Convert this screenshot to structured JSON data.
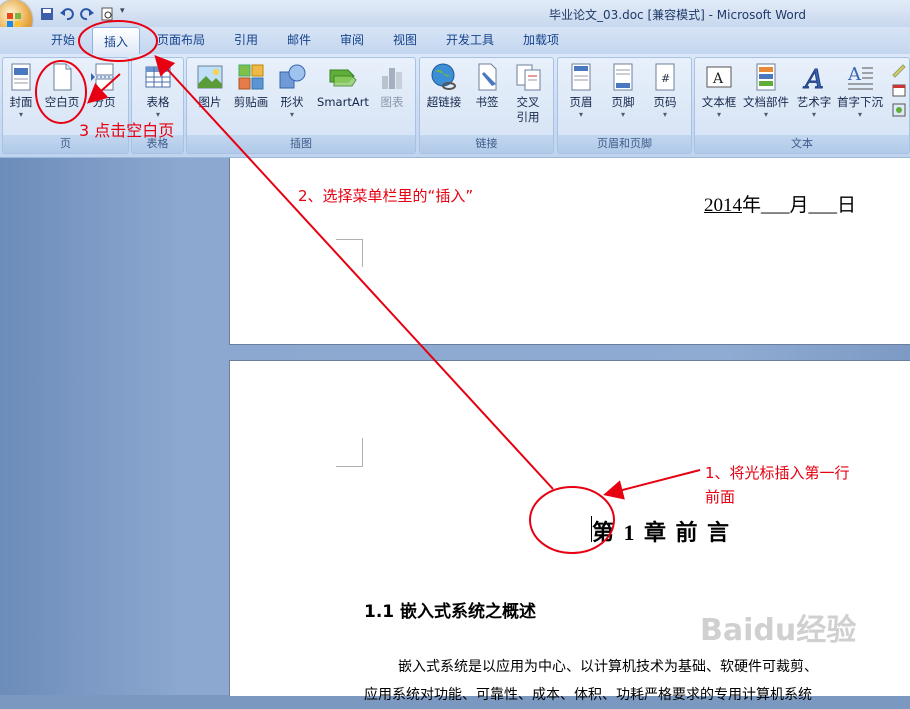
{
  "window": {
    "title": "毕业论文_03.doc [兼容模式] - Microsoft Word"
  },
  "tabs": [
    "开始",
    "插入",
    "页面布局",
    "引用",
    "邮件",
    "审阅",
    "视图",
    "开发工具",
    "加载项"
  ],
  "active_tab": "插入",
  "ribbon": {
    "pages": {
      "label": "页",
      "cover": "封面",
      "blank_page": "空白页",
      "page_break": "分页"
    },
    "tables": {
      "label": "表格",
      "table": "表格"
    },
    "illustrations": {
      "label": "插图",
      "picture": "图片",
      "clip_art": "剪贴画",
      "shapes": "形状",
      "smartart": "SmartArt",
      "chart": "图表"
    },
    "links": {
      "label": "链接",
      "hyperlink": "超链接",
      "bookmark": "书签",
      "cross_ref_line1": "交叉",
      "cross_ref_line2": "引用"
    },
    "header_footer": {
      "label": "页眉和页脚",
      "header": "页眉",
      "footer": "页脚",
      "page_number": "页码"
    },
    "text": {
      "label": "文本",
      "text_box": "文本框",
      "quick_parts": "文档部件",
      "wordart": "艺术字",
      "drop_cap": "首字下沉"
    }
  },
  "document": {
    "date_year": "2014",
    "date_rest": "年___月___日",
    "chapter_title": "第 1 章  前  言",
    "section_title": "1.1  嵌入式系统之概述",
    "para_line1": "嵌入式系统是以应用为中心、以计算机技术为基础、软硬件可裁剪、",
    "para_line2": "应用系统对功能、可靠性、成本、体积、功耗严格要求的专用计算机系统"
  },
  "annotations": {
    "step1_line1": "1、将光标插入第一行",
    "step1_line2": "前面",
    "step2": "2、选择菜单栏里的“插入”",
    "step3": "3 点击空白页"
  },
  "watermark": "Baidu经验",
  "colors": {
    "annotation": "#e60012",
    "ribbon_text": "#15428b"
  }
}
